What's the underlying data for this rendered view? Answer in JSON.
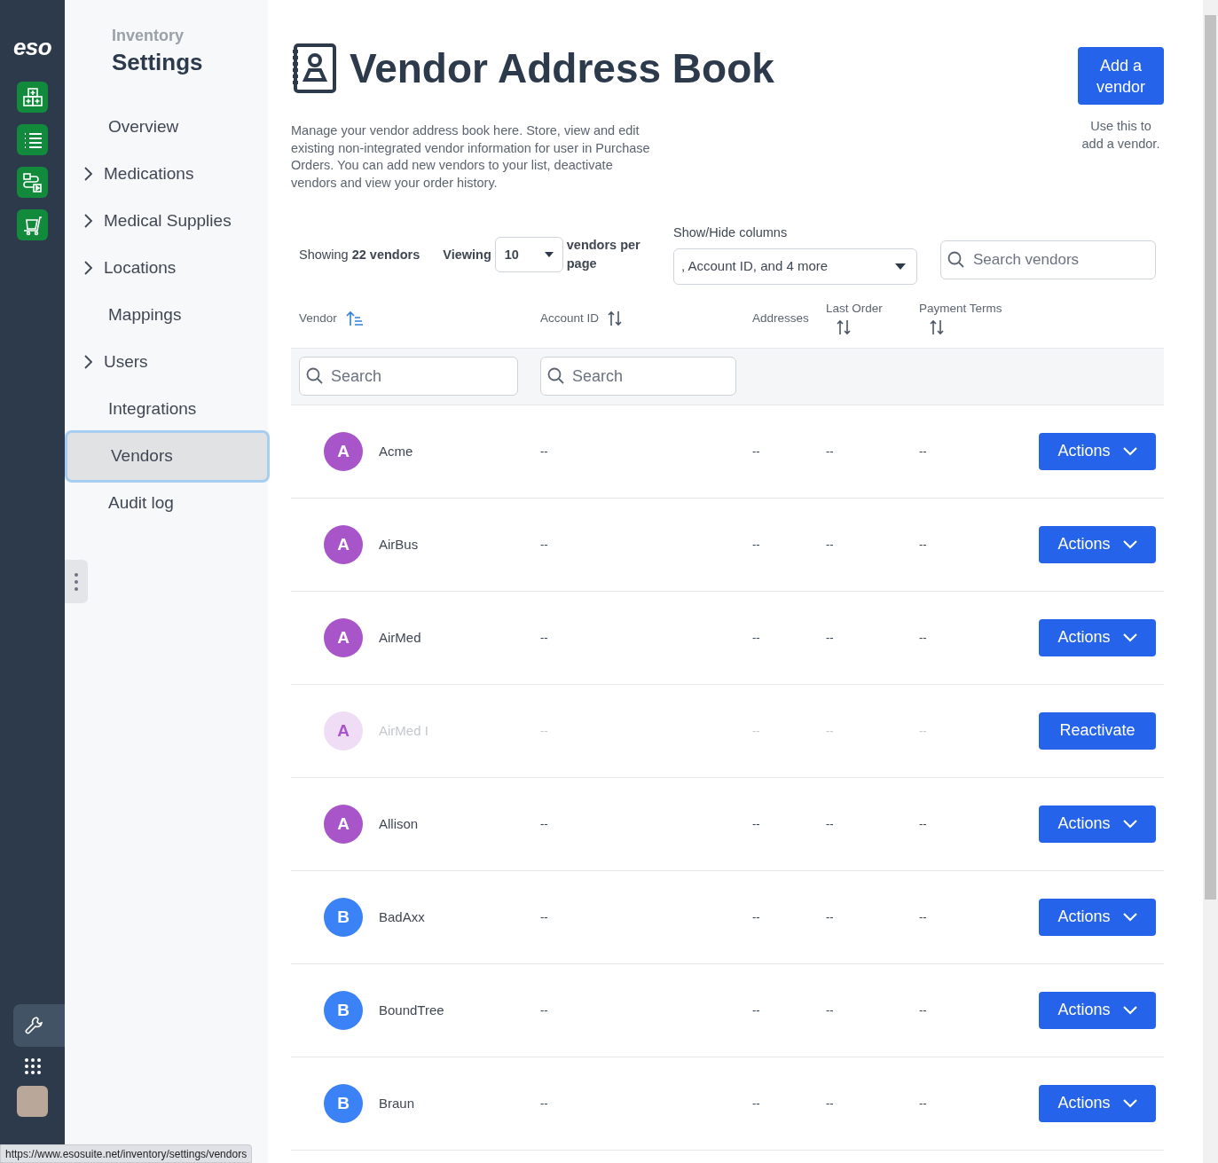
{
  "rail": {
    "logo": "eso"
  },
  "nav": {
    "eyebrow": "Inventory",
    "title": "Settings",
    "items": [
      {
        "label": "Overview",
        "expandable": false,
        "selected": false
      },
      {
        "label": "Medications",
        "expandable": true,
        "selected": false
      },
      {
        "label": "Medical Supplies",
        "expandable": true,
        "selected": false
      },
      {
        "label": "Locations",
        "expandable": true,
        "selected": false
      },
      {
        "label": "Mappings",
        "expandable": false,
        "selected": false
      },
      {
        "label": "Users",
        "expandable": true,
        "selected": false
      },
      {
        "label": "Integrations",
        "expandable": false,
        "selected": false
      },
      {
        "label": "Vendors",
        "expandable": false,
        "selected": true
      },
      {
        "label": "Audit log",
        "expandable": false,
        "selected": false
      }
    ]
  },
  "header": {
    "title": "Vendor Address Book",
    "description": "Manage your vendor address book here. Store, view and edit existing non-integrated vendor information for user in Purchase Orders. You can add new vendors to your list, deactivate vendors and view your order history.",
    "add_button": "Add a vendor",
    "add_hint": "Use this to add a vendor."
  },
  "toolbar": {
    "showing": "Showing **22 vendors**",
    "viewing_label": "Viewing",
    "page_size": "10",
    "per_page": "vendors per page",
    "columns_label": "Show/Hide columns",
    "columns_value": ", Account ID, and 4 more",
    "search_placeholder": "Search vendors"
  },
  "table": {
    "columns": [
      {
        "label": "Vendor",
        "sortable": true,
        "sorted": true,
        "filter_placeholder": "Search"
      },
      {
        "label": "Account ID",
        "sortable": true,
        "sorted": false,
        "filter_placeholder": "Search"
      },
      {
        "label": "Addresses",
        "sortable": false
      },
      {
        "label": "Last Order",
        "sortable": true,
        "sorted": false
      },
      {
        "label": "Payment Terms",
        "sortable": true,
        "sorted": false
      }
    ],
    "rows": [
      {
        "initial": "A",
        "color": "#a855c9",
        "name": "Acme",
        "account_id": "--",
        "addresses": "--",
        "last_order": "--",
        "payment_terms": "--",
        "active": true,
        "action": "Actions"
      },
      {
        "initial": "A",
        "color": "#a855c9",
        "name": "AirBus",
        "account_id": "--",
        "addresses": "--",
        "last_order": "--",
        "payment_terms": "--",
        "active": true,
        "action": "Actions"
      },
      {
        "initial": "A",
        "color": "#a855c9",
        "name": "AirMed",
        "account_id": "--",
        "addresses": "--",
        "last_order": "--",
        "payment_terms": "--",
        "active": true,
        "action": "Actions"
      },
      {
        "initial": "A",
        "color": "#a855c9",
        "name": "AirMed I",
        "account_id": "--",
        "addresses": "--",
        "last_order": "--",
        "payment_terms": "--",
        "active": false,
        "action": "Reactivate"
      },
      {
        "initial": "A",
        "color": "#a855c9",
        "name": "Allison",
        "account_id": "--",
        "addresses": "--",
        "last_order": "--",
        "payment_terms": "--",
        "active": true,
        "action": "Actions"
      },
      {
        "initial": "B",
        "color": "#3b82f6",
        "name": "BadAxx",
        "account_id": "--",
        "addresses": "--",
        "last_order": "--",
        "payment_terms": "--",
        "active": true,
        "action": "Actions"
      },
      {
        "initial": "B",
        "color": "#3b82f6",
        "name": "BoundTree",
        "account_id": "--",
        "addresses": "--",
        "last_order": "--",
        "payment_terms": "--",
        "active": true,
        "action": "Actions"
      },
      {
        "initial": "B",
        "color": "#3b82f6",
        "name": "Braun",
        "account_id": "--",
        "addresses": "--",
        "last_order": "--",
        "payment_terms": "--",
        "active": true,
        "action": "Actions"
      }
    ]
  },
  "status_url": "https://www.esosuite.net/inventory/settings/vendors"
}
